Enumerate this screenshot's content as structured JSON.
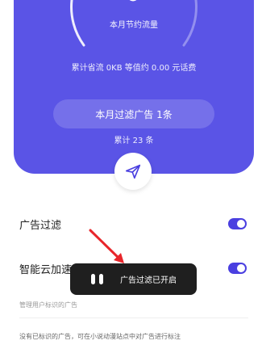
{
  "hero": {
    "month_label": "本月节约流量",
    "saved_label": "累计省流 0KB 等值约 0.00 元话费",
    "filter_button": "本月过滤广告 1条",
    "total_label": "累计 23 条",
    "color": "#5a54e6"
  },
  "settings": {
    "ad_filter_label": "广告过滤",
    "ad_filter_on": true,
    "cloud_accel_label": "智能云加速",
    "cloud_accel_on": true,
    "toggle_color": "#4a3fe0"
  },
  "section_caption": "管理用户标识的广告",
  "footer_note": "没有已标识的广告，可在小说动漫站点中对广告进行标注",
  "toast": {
    "text": "广告过滤已开启"
  },
  "icons": {
    "send": "paper-plane-icon",
    "toast": "pause-icon"
  },
  "annotation_color": "#e8262b"
}
